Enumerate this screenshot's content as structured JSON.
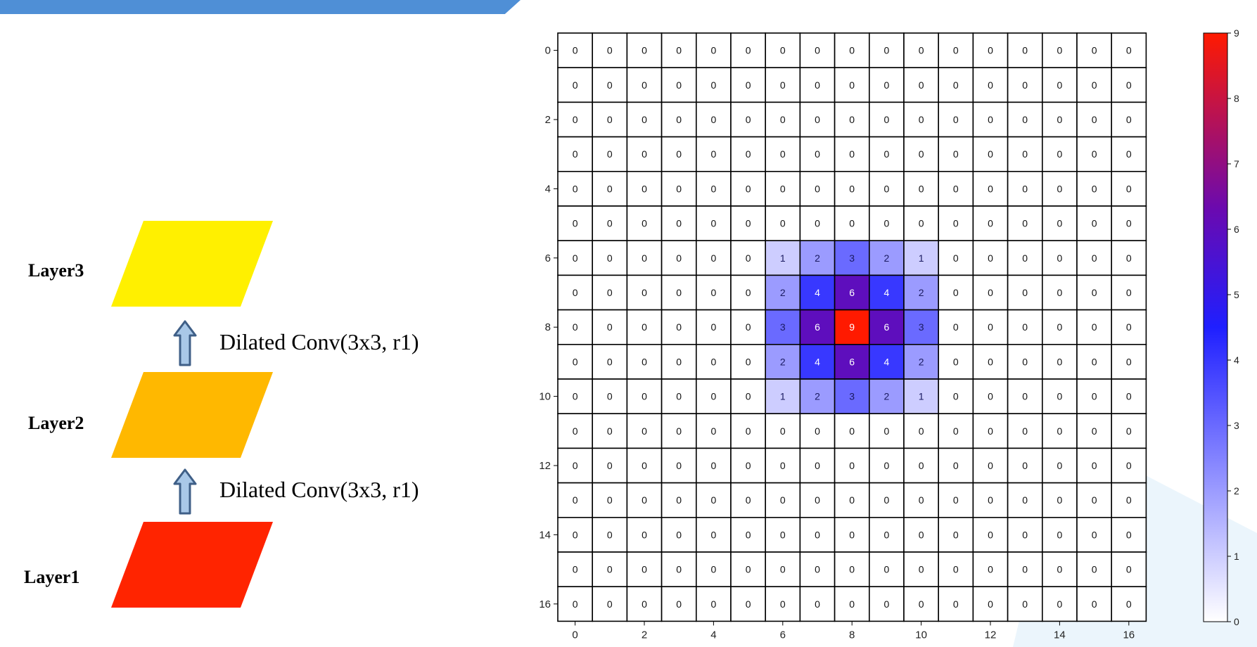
{
  "diagram": {
    "layers": [
      {
        "label": "Layer3",
        "color": "#fff000"
      },
      {
        "label": "Layer2",
        "color": "#ffb800"
      },
      {
        "label": "Layer1",
        "color": "#ff2400"
      }
    ],
    "operations": [
      {
        "label": "Dilated Conv(3x3, r1)"
      },
      {
        "label": "Dilated Conv(3x3, r1)"
      }
    ]
  },
  "chart_data": {
    "type": "heatmap",
    "rows": 17,
    "cols": 17,
    "x_ticks": [
      0,
      2,
      4,
      6,
      8,
      10,
      12,
      14,
      16
    ],
    "y_ticks": [
      0,
      2,
      4,
      6,
      8,
      10,
      12,
      14,
      16
    ],
    "nonzero": [
      {
        "row": 6,
        "values": [
          1,
          2,
          3,
          2,
          1
        ],
        "col_start": 6
      },
      {
        "row": 7,
        "values": [
          2,
          4,
          6,
          4,
          2
        ],
        "col_start": 6
      },
      {
        "row": 8,
        "values": [
          3,
          6,
          9,
          6,
          3
        ],
        "col_start": 6
      },
      {
        "row": 9,
        "values": [
          2,
          4,
          6,
          4,
          2
        ],
        "col_start": 6
      },
      {
        "row": 10,
        "values": [
          1,
          2,
          3,
          2,
          1
        ],
        "col_start": 6
      }
    ],
    "colorbar": {
      "min": 0,
      "max": 9,
      "ticks": [
        0,
        1,
        2,
        3,
        4,
        5,
        6,
        7,
        8,
        9
      ],
      "colors": [
        "#ffffff",
        "#1f1fff",
        "#6a0ab0",
        "#ff1a00"
      ]
    },
    "grid": true
  }
}
